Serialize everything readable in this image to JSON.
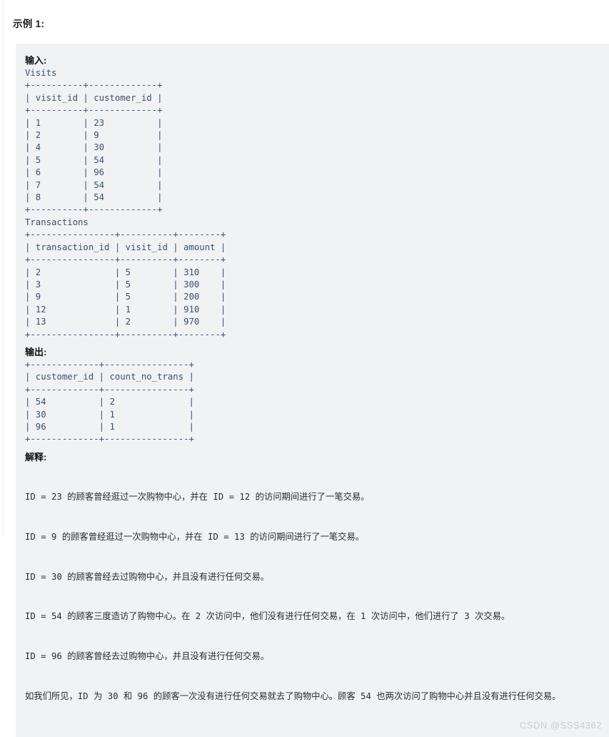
{
  "page": {
    "example_title": "示例 1:",
    "watermark": "CSDN @SSS4362"
  },
  "input_section": {
    "label": "输入:",
    "visits_table_name": "Visits",
    "visits_table": "+----------+-------------+\n| visit_id | customer_id |\n+----------+-------------+\n| 1        | 23          |\n| 2        | 9           |\n| 4        | 30          |\n| 5        | 54          |\n| 6        | 96          |\n| 7        | 54          |\n| 8        | 54          |\n+----------+-------------+",
    "transactions_table_name": "Transactions",
    "transactions_table": "+----------------+----------+--------+\n| transaction_id | visit_id | amount |\n+----------------+----------+--------+\n| 2              | 5        | 310    |\n| 3              | 5        | 300    |\n| 9              | 5        | 200    |\n| 12             | 1        | 910    |\n| 13             | 2        | 970    |\n+----------------+----------+--------+"
  },
  "output_section": {
    "label": "输出:",
    "result_table": "+-------------+----------------+\n| customer_id | count_no_trans |\n+-------------+----------------+\n| 54          | 2              |\n| 30          | 1              |\n| 96          | 1              |\n+-------------+----------------+"
  },
  "explanation_section": {
    "label": "解释:",
    "lines": [
      "ID = 23 的顾客曾经逛过一次购物中心，并在 ID = 12 的访问期间进行了一笔交易。",
      "ID = 9 的顾客曾经逛过一次购物中心，并在 ID = 13 的访问期间进行了一笔交易。",
      "ID = 30 的顾客曾经去过购物中心，并且没有进行任何交易。",
      "ID = 54 的顾客三度造访了购物中心。在 2 次访问中，他们没有进行任何交易，在 1 次访问中，他们进行了 3 次交易。",
      "ID = 96 的顾客曾经去过购物中心，并且没有进行任何交易。",
      "如我们所见，ID 为 30 和 96 的顾客一次没有进行任何交易就去了购物中心。顾客 54 也两次访问了购物中心并且没有进行任何交易。"
    ]
  },
  "data_tables": {
    "visits": {
      "columns": [
        "visit_id",
        "customer_id"
      ],
      "rows": [
        [
          1,
          23
        ],
        [
          2,
          9
        ],
        [
          4,
          30
        ],
        [
          5,
          54
        ],
        [
          6,
          96
        ],
        [
          7,
          54
        ],
        [
          8,
          54
        ]
      ]
    },
    "transactions": {
      "columns": [
        "transaction_id",
        "visit_id",
        "amount"
      ],
      "rows": [
        [
          2,
          5,
          310
        ],
        [
          3,
          5,
          300
        ],
        [
          9,
          5,
          200
        ],
        [
          12,
          1,
          910
        ],
        [
          13,
          2,
          970
        ]
      ]
    },
    "result": {
      "columns": [
        "customer_id",
        "count_no_trans"
      ],
      "rows": [
        [
          54,
          2
        ],
        [
          30,
          1
        ],
        [
          96,
          1
        ]
      ]
    }
  },
  "colors": {
    "code_background": "#f1f2f4",
    "code_text": "#3b5070",
    "page_background": "#ffffff",
    "watermark": "#c9ccd1"
  }
}
